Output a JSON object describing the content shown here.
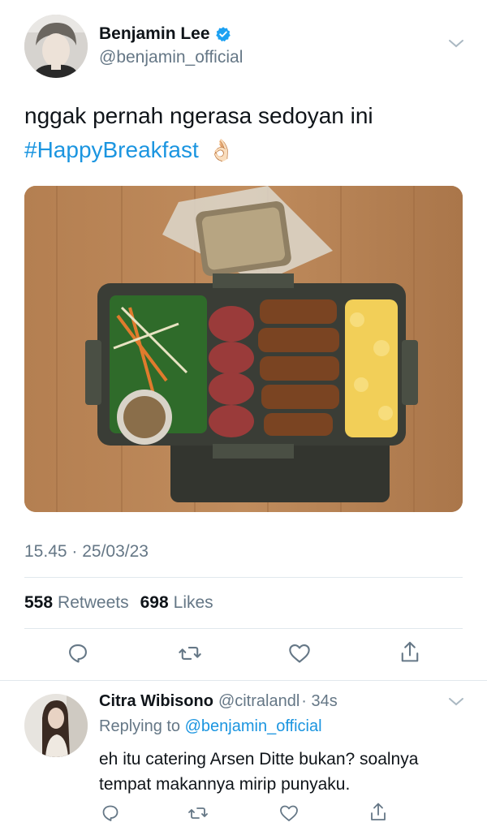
{
  "tweet": {
    "author_name": "Benjamin Lee",
    "author_handle": "@benjamin_official",
    "text_line1": "nggak pernah ngerasa sedoyan ini",
    "hashtag": "#HappyBreakfast",
    "emoji": "👌🏻",
    "timestamp": "15.45 · 25/03/23",
    "retweets_count": "558",
    "retweets_label": "Retweets",
    "likes_count": "698",
    "likes_label": "Likes"
  },
  "reply": {
    "author_name": "Citra Wibisono",
    "author_handle": "@citralandl",
    "time": "· 34s",
    "replying_prefix": "Replying to",
    "replying_handle": "@benjamin_official",
    "text_line1": "eh itu catering Arsen Ditte bukan? soalnya",
    "text_line2": "tempat makannya mirip punyaku."
  },
  "icons": [
    "verified-badge-icon",
    "chevron-down-icon",
    "reply-icon",
    "retweet-icon",
    "like-icon",
    "share-icon"
  ],
  "colors": {
    "link": "#1b95e0",
    "secondary": "#657786",
    "verified": "#1da1f2",
    "divider": "#e1e8ed"
  }
}
